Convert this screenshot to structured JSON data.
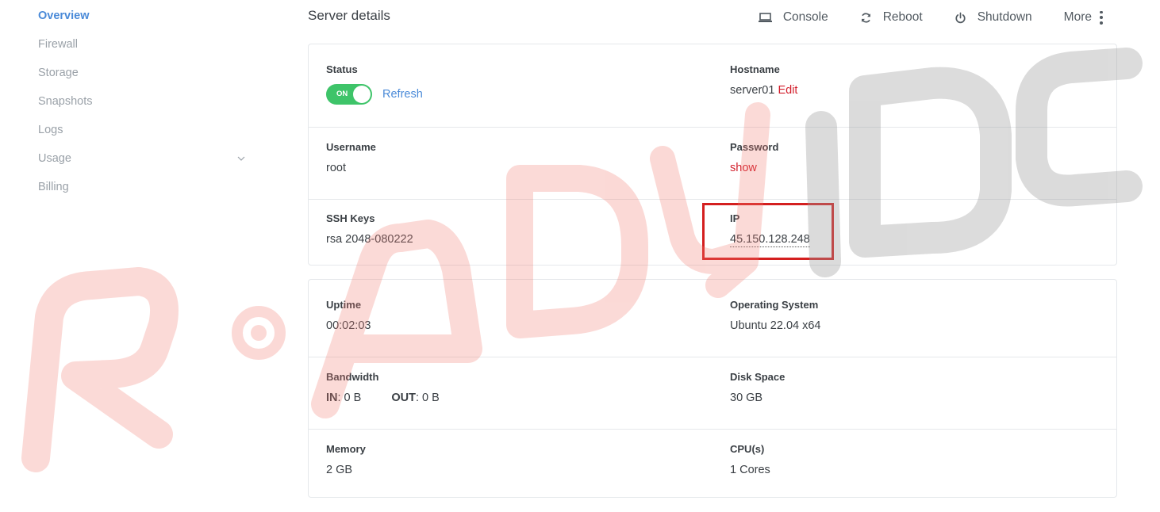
{
  "sidebar": {
    "items": [
      {
        "label": "Overview"
      },
      {
        "label": "Firewall"
      },
      {
        "label": "Storage"
      },
      {
        "label": "Snapshots"
      },
      {
        "label": "Logs"
      },
      {
        "label": "Usage"
      },
      {
        "label": "Billing"
      }
    ]
  },
  "header": {
    "title": "Server details",
    "actions": {
      "console": "Console",
      "reboot": "Reboot",
      "shutdown": "Shutdown",
      "more": "More"
    }
  },
  "details": {
    "status": {
      "label": "Status",
      "toggle": "ON",
      "refresh": "Refresh"
    },
    "hostname": {
      "label": "Hostname",
      "value": "server01",
      "edit": "Edit"
    },
    "username": {
      "label": "Username",
      "value": "root"
    },
    "password": {
      "label": "Password",
      "show": "show"
    },
    "ssh_keys": {
      "label": "SSH Keys",
      "value": "rsa 2048-080222"
    },
    "ip": {
      "label": "IP",
      "value": "45.150.128.248"
    }
  },
  "specs": {
    "uptime": {
      "label": "Uptime",
      "value": "00:02:03"
    },
    "os": {
      "label": "Operating System",
      "value": "Ubuntu 22.04 x64"
    },
    "bandwidth": {
      "label": "Bandwidth",
      "in_label": "IN",
      "in_value": ": 0 B",
      "out_label": "OUT",
      "out_value": ": 0 B"
    },
    "disk": {
      "label": "Disk Space",
      "value": "30 GB"
    },
    "memory": {
      "label": "Memory",
      "value": "2 GB"
    },
    "cpu": {
      "label": "CPU(s)",
      "value": "1 Cores"
    }
  },
  "colors": {
    "accent": "#4a8ad8",
    "toggle_on": "#3ec469",
    "link_red": "#d21e2b",
    "highlight": "#d41f1f"
  }
}
